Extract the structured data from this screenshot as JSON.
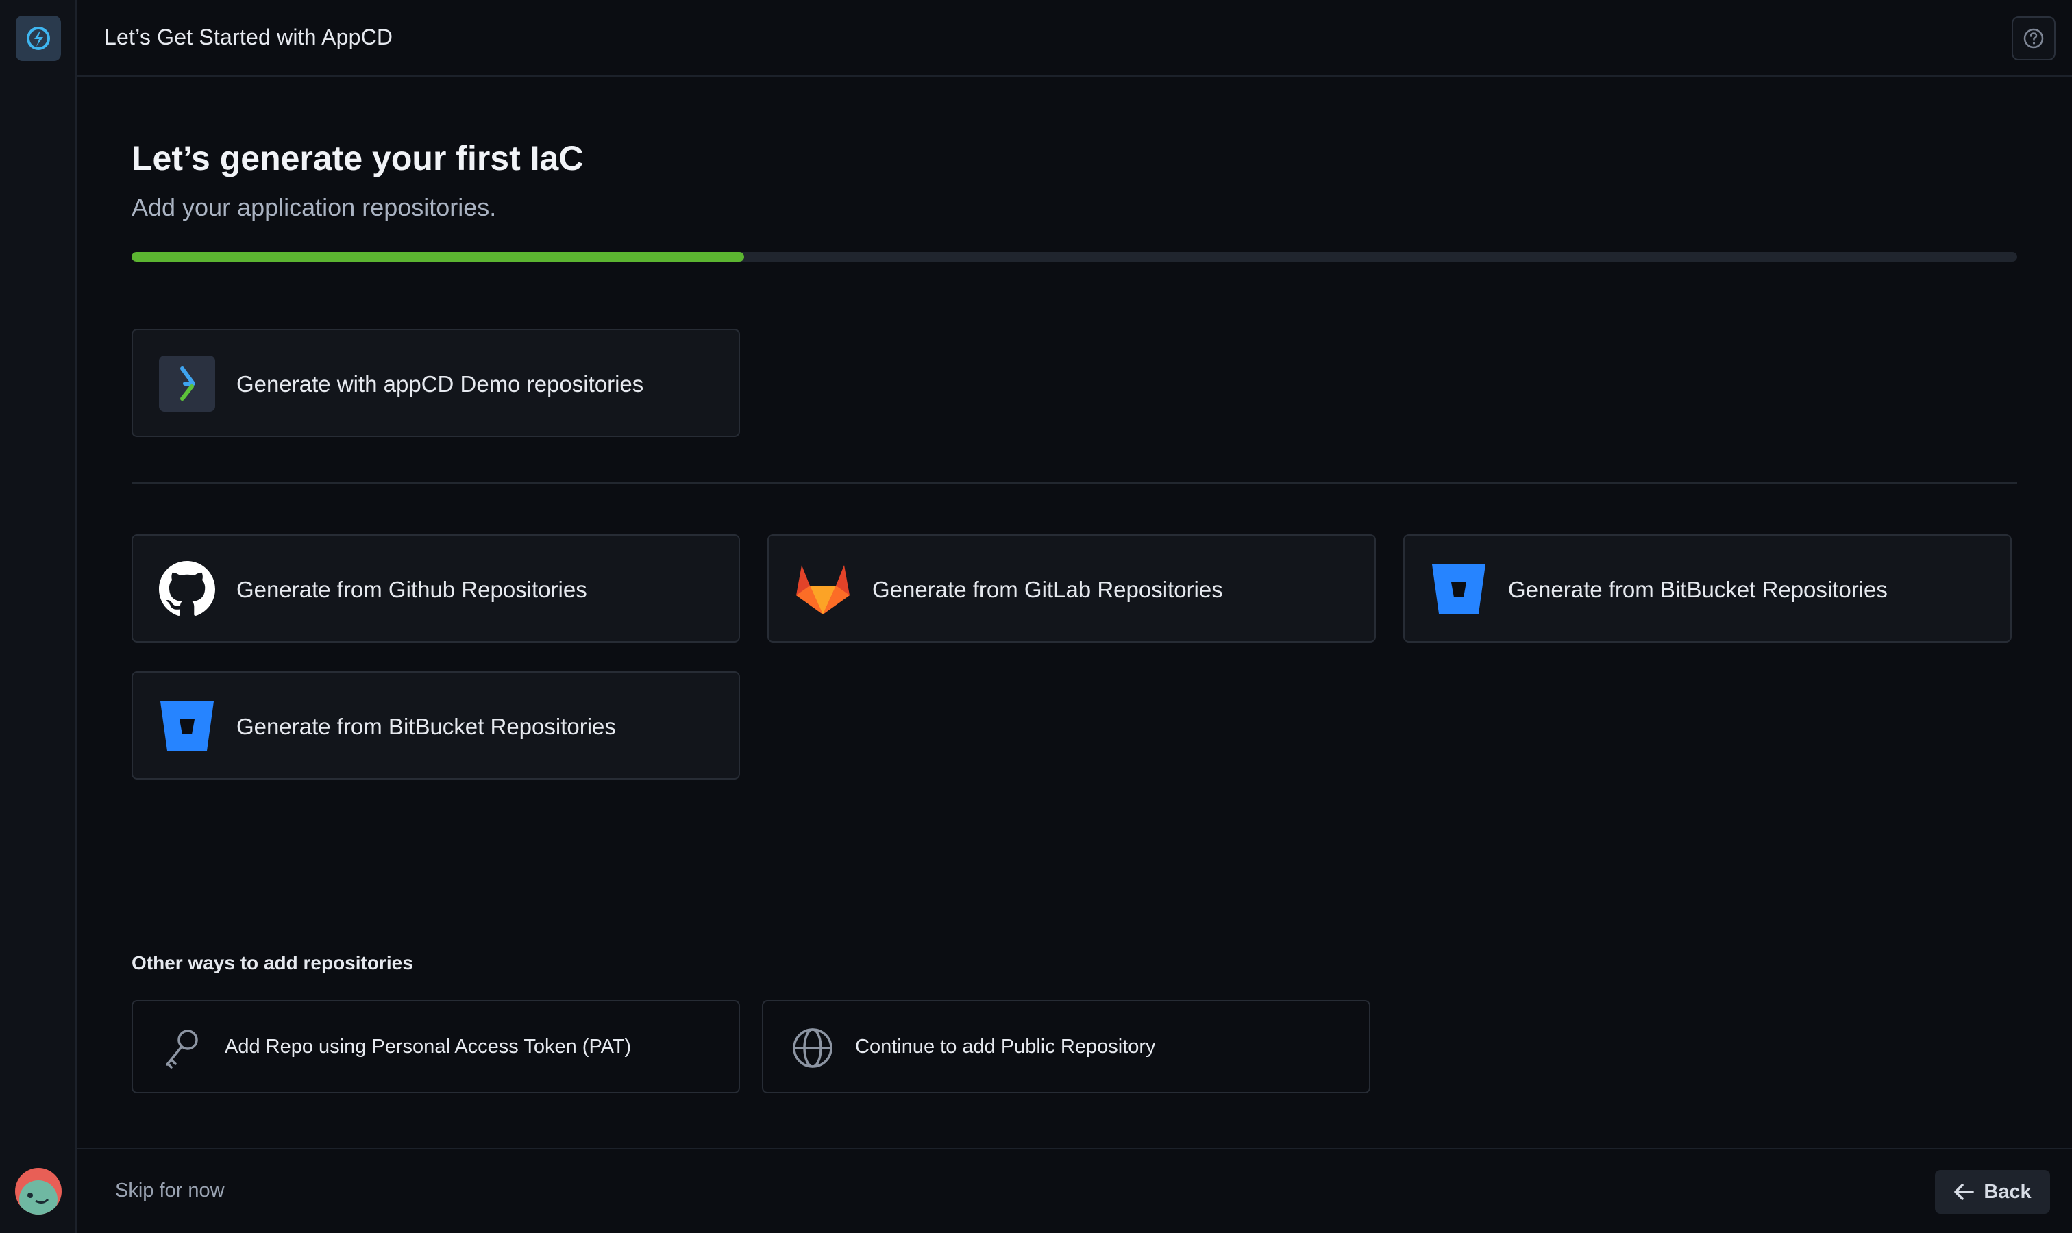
{
  "app": {
    "title": "Let’s Get Started with AppCD"
  },
  "page": {
    "heading": "Let’s generate your first IaC",
    "subheading": "Add your application repositories.",
    "progress": 0.325
  },
  "cards": {
    "demo": "Generate with appCD Demo repositories",
    "github": "Generate from Github Repositories",
    "gitlab": "Generate from GitLab Repositories",
    "bitbucket_1": "Generate from BitBucket Repositories",
    "bitbucket_2": "Generate from BitBucket Repositories"
  },
  "other": {
    "section_label": "Other ways to add repositories",
    "pat": "Add Repo using Personal Access Token (PAT)",
    "public": "Continue to add Public Repository"
  },
  "footer": {
    "skip": "Skip for now",
    "back": "Back"
  },
  "colors": {
    "accent_green": "#5cb531",
    "gitlab_orange": "#e24329",
    "bitbucket_blue": "#2684ff"
  }
}
